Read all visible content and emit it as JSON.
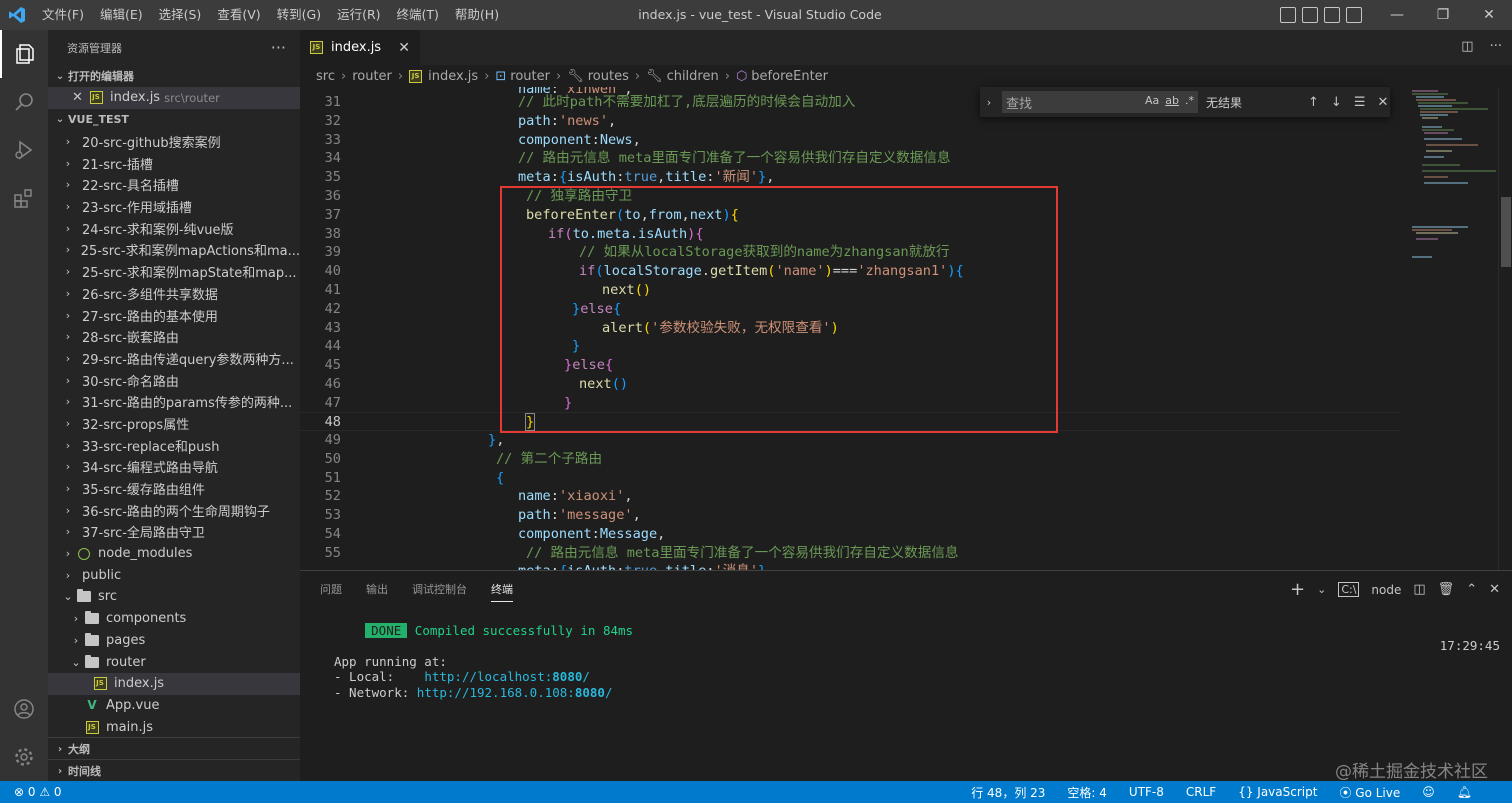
{
  "window": {
    "title": "index.js - vue_test - Visual Studio Code",
    "menu": [
      "文件(F)",
      "编辑(E)",
      "选择(S)",
      "查看(V)",
      "转到(G)",
      "运行(R)",
      "终端(T)",
      "帮助(H)"
    ]
  },
  "sidebar": {
    "title": "资源管理器",
    "open_editors_header": "打开的编辑器",
    "open_editor": {
      "name": "index.js",
      "path": "src\\router"
    },
    "project_header": "VUE_TEST",
    "tree": [
      {
        "label": "20-src-github搜索案例"
      },
      {
        "label": "21-src-插槽"
      },
      {
        "label": "22-src-具名插槽"
      },
      {
        "label": "23-src-作用域插槽"
      },
      {
        "label": "24-src-求和案例-纯vue版"
      },
      {
        "label": "25-src-求和案例mapActions和ma..."
      },
      {
        "label": "25-src-求和案例mapState和map..."
      },
      {
        "label": "26-src-多组件共享数据"
      },
      {
        "label": "27-src-路由的基本使用"
      },
      {
        "label": "28-src-嵌套路由"
      },
      {
        "label": "29-src-路由传递query参数两种方..."
      },
      {
        "label": "30-src-命名路由"
      },
      {
        "label": "31-src-路由的params传参的两种..."
      },
      {
        "label": "32-src-props属性"
      },
      {
        "label": "33-src-replace和push"
      },
      {
        "label": "34-src-编程式路由导航"
      },
      {
        "label": "35-src-缓存路由组件"
      },
      {
        "label": "36-src-路由的两个生命周期钩子"
      },
      {
        "label": "37-src-全局路由守卫"
      },
      {
        "label": "node_modules"
      },
      {
        "label": "public"
      }
    ],
    "src_folder": "src",
    "src_children": [
      "components",
      "pages",
      "router"
    ],
    "router_file": "index.js",
    "app_vue": "App.vue",
    "main_js": "main.js",
    "outline_header": "大纲",
    "timeline_header": "时间线"
  },
  "editor": {
    "tab_label": "index.js",
    "breadcrumb": [
      "src",
      "router",
      "index.js",
      "router",
      "routes",
      "children",
      "beforeEnter"
    ],
    "find": {
      "placeholder": "查找",
      "result": "无结果",
      "opt_case": "Aa",
      "opt_word": "ab",
      "opt_regex": ".*"
    },
    "line_numbers": [
      "31",
      "32",
      "33",
      "34",
      "35",
      "36",
      "37",
      "38",
      "39",
      "40",
      "41",
      "42",
      "43",
      "44",
      "45",
      "46",
      "47",
      "48",
      "49",
      "50",
      "51",
      "52",
      "53",
      "54",
      "55"
    ],
    "code": {
      "l31_comment": "// 此时path不需要加杠了,底层遍历的时候会自动加入",
      "l32_prop": "path",
      "l32_val": "'news'",
      "l33_prop": "component",
      "l33_val": "News",
      "l34_comment": "// 路由元信息 meta里面专门准备了一个容易供我们存自定义数据信息",
      "l35_prop": "meta",
      "l35_k1": "isAuth",
      "l35_v1": "true",
      "l35_k2": "title",
      "l35_v2": "'新闻'",
      "l36_comment": "// 独享路由守卫",
      "l37_fn": "beforeEnter",
      "l37_p1": "to",
      "l37_p2": "from",
      "l37_p3": "next",
      "l38_kw": "if",
      "l38_expr": "to.meta.isAuth",
      "l39_comment": "// 如果从localStorage获取到的name为zhangsan就放行",
      "l40_kw": "if",
      "l40_obj": "localStorage",
      "l40_fn": "getItem",
      "l40_arg": "'name'",
      "l40_op": "===",
      "l40_val": "'zhangsan1'",
      "l41_fn": "next",
      "l42_kw": "else",
      "l43_fn": "alert",
      "l43_arg": "'参数校验失败，无权限查看'",
      "l45_kw": "else",
      "l46_fn": "next",
      "l50_comment": "// 第二个子路由",
      "l52_prop": "name",
      "l52_val": "'xiaoxi'",
      "l53_prop": "path",
      "l53_val": "'message'",
      "l54_prop": "component",
      "l54_val": "Message",
      "l55_comment": "// 路由元信息 meta里面专门准备了一个容易供我们存自定义数据信息"
    }
  },
  "panel": {
    "tabs": [
      "问题",
      "输出",
      "调试控制台",
      "终端"
    ],
    "active_tab": "终端",
    "shell": "node",
    "terminal": {
      "done_badge": "DONE",
      "compiled": "Compiled successfully in 84ms",
      "time": "17:29:45",
      "running": "App running at:",
      "local_label": "- Local:   ",
      "local_url_a": "http://localhost:",
      "local_port": "8080",
      "network_label": "- Network: ",
      "network_url_a": "http://192.168.0.108:",
      "network_port": "8080"
    }
  },
  "statusbar": {
    "problems": "⊗ 0 ⚠ 0",
    "position": "行 48，列 23",
    "spaces": "空格: 4",
    "encoding": "UTF-8",
    "eol": "CRLF",
    "language": "{} JavaScript",
    "golive": "Go Live"
  },
  "watermark": "@稀土掘金技术社区",
  "colors": {
    "accent": "#007acc",
    "highlight_box": "#e53935"
  }
}
